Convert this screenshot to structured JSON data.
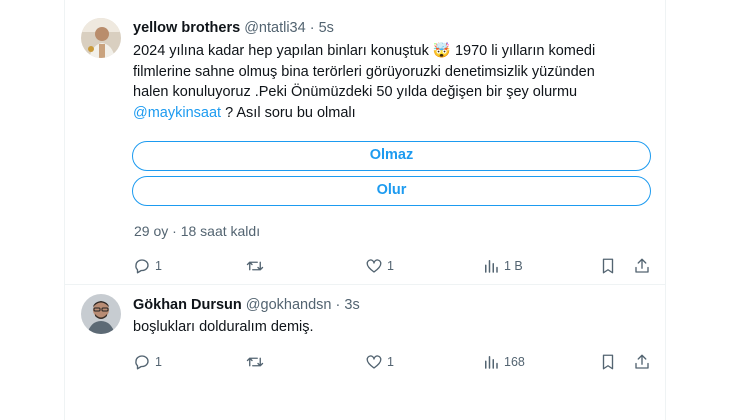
{
  "tweet1": {
    "name": "yellow brothers",
    "handle": "@ntatli34",
    "sep": "·",
    "time": "5s",
    "text_line1": "2024 yılına kadar hep yapılan binları konuştuk 🤯 1970 li yılların komedi",
    "text_line2": "filmlerine sahne olmuş bina terörleri görüyoruzki denetimsizlik yüzünden",
    "text_line3": "halen konuluyoruz .Peki Önümüzdeki 50 yılda değişen bir şey olurmu",
    "mention": "@maykinsaat",
    "text_after_mention": " ? Asıl soru bu olmalı",
    "poll": {
      "options": [
        "Olmaz",
        "Olur"
      ],
      "votes": "29 oy",
      "sep": "·",
      "remaining": "18 saat kaldı"
    },
    "actions": {
      "replies": "1",
      "likes": "1",
      "views": "1 B"
    }
  },
  "tweet2": {
    "name": "Gökhan Dursun",
    "handle": "@gokhandsn",
    "sep": "·",
    "time": "3s",
    "text": "boşlukları dolduralım demiş.",
    "actions": {
      "replies": "1",
      "likes": "1",
      "views": "168"
    }
  },
  "colors": {
    "accent": "#1d9bf0",
    "secondary_text": "#536471",
    "primary_text": "#0f1419"
  }
}
